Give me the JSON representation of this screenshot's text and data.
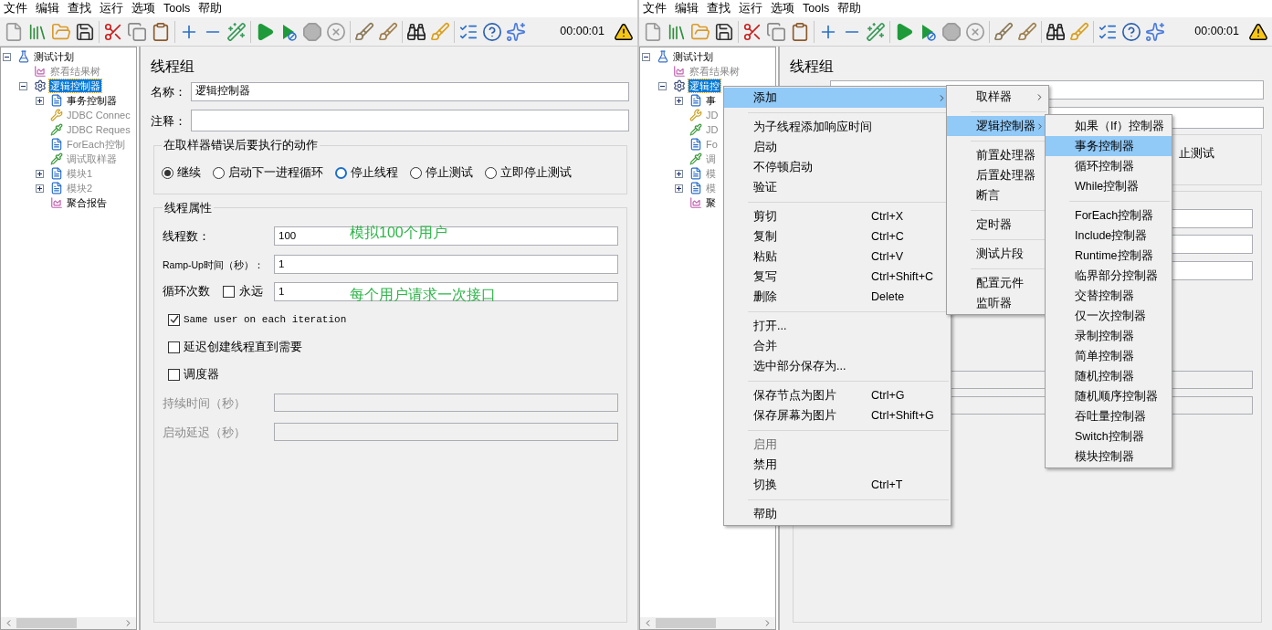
{
  "left": {
    "menubar": [
      "文件",
      "编辑",
      "查找",
      "运行",
      "选项",
      "Tools",
      "帮助"
    ],
    "toolbar": {
      "timer": "00:00:01"
    },
    "tree": [
      {
        "label": "测试计划",
        "kind": "plan",
        "selected": false,
        "disabled": false,
        "expanded": true,
        "children": [
          {
            "label": "察看结果树",
            "kind": "listener",
            "selected": false,
            "disabled": true
          },
          {
            "label": "逻辑控制器",
            "kind": "gear",
            "selected": true,
            "disabled": false,
            "expanded": true,
            "children": [
              {
                "label": "事务控制器",
                "kind": "controller",
                "selected": false,
                "disabled": false,
                "expanded": false
              },
              {
                "label": "JDBC Connec",
                "kind": "config",
                "selected": false,
                "disabled": true
              },
              {
                "label": "JDBC Reques",
                "kind": "sampler",
                "selected": false,
                "disabled": true
              },
              {
                "label": "ForEach控制",
                "kind": "controller",
                "selected": false,
                "disabled": true
              },
              {
                "label": "调试取样器",
                "kind": "sampler",
                "selected": false,
                "disabled": true
              },
              {
                "label": "模块1",
                "kind": "controller",
                "selected": false,
                "disabled": true,
                "expanded": false
              },
              {
                "label": "模块2",
                "kind": "controller",
                "selected": false,
                "disabled": true,
                "expanded": false
              },
              {
                "label": "聚合报告",
                "kind": "listener",
                "selected": false,
                "disabled": false
              }
            ]
          }
        ]
      }
    ],
    "form": {
      "title": "线程组",
      "name": {
        "label": "名称：",
        "value": "逻辑控制器"
      },
      "comment": {
        "label": "注释："
      },
      "error_action": {
        "title": "在取样器错误后要执行的动作",
        "options": [
          {
            "label": "继续",
            "selected": true,
            "focused": false
          },
          {
            "label": "启动下一进程循环",
            "selected": false,
            "focused": false
          },
          {
            "label": "停止线程",
            "selected": false,
            "focused": true
          },
          {
            "label": "停止测试",
            "selected": false,
            "focused": false
          },
          {
            "label": "立即停止测试",
            "selected": false,
            "focused": false
          }
        ]
      },
      "thread_props": {
        "title": "线程属性",
        "threads": {
          "label": "线程数：",
          "value": "100",
          "annotation": "模拟100个用户"
        },
        "rampup": {
          "label": "Ramp-Up时间（秒）：",
          "value": "1"
        },
        "loops": {
          "label": "循环次数",
          "forever": {
            "label": "永远",
            "checked": false
          },
          "value": "1",
          "annotation": "每个用户请求一次接口"
        },
        "checks": [
          {
            "label": "Same user on each iteration",
            "checked": true
          },
          {
            "label": "延迟创建线程直到需要",
            "checked": false
          },
          {
            "label": "调度器",
            "checked": false
          }
        ],
        "duration": {
          "label": "持续时间（秒）",
          "disabled": true
        },
        "delay": {
          "label": "启动延迟（秒）",
          "disabled": true
        }
      }
    }
  },
  "right": {
    "menubar": [
      "文件",
      "编辑",
      "查找",
      "运行",
      "选项",
      "Tools",
      "帮助"
    ],
    "toolbar": {
      "timer": "00:00:01"
    },
    "tree": [
      {
        "label": "测试计划",
        "kind": "plan",
        "selected": false,
        "disabled": false,
        "expanded": true,
        "children": [
          {
            "label": "察看结果树",
            "kind": "listener",
            "selected": false,
            "disabled": true
          },
          {
            "label": "逻辑控",
            "kind": "gear",
            "selected": true,
            "disabled": false,
            "expanded": true,
            "children": [
              {
                "label": "事",
                "kind": "controller",
                "selected": false,
                "disabled": false,
                "expanded": false
              },
              {
                "label": "JD",
                "kind": "config",
                "selected": false,
                "disabled": true
              },
              {
                "label": "JD",
                "kind": "sampler",
                "selected": false,
                "disabled": true
              },
              {
                "label": "Fo",
                "kind": "controller",
                "selected": false,
                "disabled": true
              },
              {
                "label": "调",
                "kind": "sampler",
                "selected": false,
                "disabled": true
              },
              {
                "label": "模",
                "kind": "controller",
                "selected": false,
                "disabled": true,
                "expanded": false
              },
              {
                "label": "模",
                "kind": "controller",
                "selected": false,
                "disabled": true,
                "expanded": false
              },
              {
                "label": "聚",
                "kind": "listener",
                "selected": false,
                "disabled": false
              }
            ]
          }
        ]
      }
    ],
    "form": {
      "title": "线程组",
      "error_action": {
        "fragment": "止测试"
      },
      "thread_props": {
        "duration": {
          "disabled": true
        },
        "delay": {
          "disabled": true
        }
      }
    },
    "context_menu": [
      {
        "kind": "item",
        "label": "添加",
        "submenu": true,
        "selected": true,
        "disabled": false
      },
      {
        "kind": "separator"
      },
      {
        "kind": "item",
        "label": "为子线程添加响应时间",
        "submenu": false,
        "selected": false,
        "disabled": false
      },
      {
        "kind": "item",
        "label": "启动",
        "submenu": false,
        "selected": false,
        "disabled": false
      },
      {
        "kind": "item",
        "label": "不停顿启动",
        "submenu": false,
        "selected": false,
        "disabled": false
      },
      {
        "kind": "item",
        "label": "验证",
        "submenu": false,
        "selected": false,
        "disabled": false
      },
      {
        "kind": "separator"
      },
      {
        "kind": "item",
        "label": "剪切",
        "shortcut": "Ctrl+X",
        "submenu": false,
        "selected": false,
        "disabled": false
      },
      {
        "kind": "item",
        "label": "复制",
        "shortcut": "Ctrl+C",
        "submenu": false,
        "selected": false,
        "disabled": false
      },
      {
        "kind": "item",
        "label": "粘贴",
        "shortcut": "Ctrl+V",
        "submenu": false,
        "selected": false,
        "disabled": false
      },
      {
        "kind": "item",
        "label": "复写",
        "shortcut": "Ctrl+Shift+C",
        "submenu": false,
        "selected": false,
        "disabled": false
      },
      {
        "kind": "item",
        "label": "删除",
        "shortcut": "Delete",
        "submenu": false,
        "selected": false,
        "disabled": false
      },
      {
        "kind": "separator"
      },
      {
        "kind": "item",
        "label": "打开...",
        "submenu": false,
        "selected": false,
        "disabled": false
      },
      {
        "kind": "item",
        "label": "合并",
        "submenu": false,
        "selected": false,
        "disabled": false
      },
      {
        "kind": "item",
        "label": "选中部分保存为...",
        "submenu": false,
        "selected": false,
        "disabled": false
      },
      {
        "kind": "separator"
      },
      {
        "kind": "item",
        "label": "保存节点为图片",
        "shortcut": "Ctrl+G",
        "submenu": false,
        "selected": false,
        "disabled": false
      },
      {
        "kind": "item",
        "label": "保存屏幕为图片",
        "shortcut": "Ctrl+Shift+G",
        "submenu": false,
        "selected": false,
        "disabled": false
      },
      {
        "kind": "separator"
      },
      {
        "kind": "item",
        "label": "启用",
        "submenu": false,
        "selected": false,
        "disabled": true
      },
      {
        "kind": "item",
        "label": "禁用",
        "submenu": false,
        "selected": false,
        "disabled": false
      },
      {
        "kind": "item",
        "label": "切换",
        "shortcut": "Ctrl+T",
        "submenu": false,
        "selected": false,
        "disabled": false
      },
      {
        "kind": "separator"
      },
      {
        "kind": "item",
        "label": "帮助",
        "submenu": false,
        "selected": false,
        "disabled": false
      }
    ],
    "add_submenu": [
      {
        "kind": "item",
        "label": "取样器",
        "submenu": true,
        "selected": false,
        "disabled": false
      },
      {
        "kind": "separator"
      },
      {
        "kind": "item",
        "label": "逻辑控制器",
        "submenu": true,
        "selected": true,
        "disabled": false
      },
      {
        "kind": "separator"
      },
      {
        "kind": "item",
        "label": "前置处理器",
        "submenu": false,
        "selected": false,
        "disabled": false
      },
      {
        "kind": "item",
        "label": "后置处理器",
        "submenu": false,
        "selected": false,
        "disabled": false
      },
      {
        "kind": "item",
        "label": "断言",
        "submenu": false,
        "selected": false,
        "disabled": false
      },
      {
        "kind": "separator"
      },
      {
        "kind": "item",
        "label": "定时器",
        "submenu": false,
        "selected": false,
        "disabled": false
      },
      {
        "kind": "separator"
      },
      {
        "kind": "item",
        "label": "测试片段",
        "submenu": false,
        "selected": false,
        "disabled": false
      },
      {
        "kind": "separator"
      },
      {
        "kind": "item",
        "label": "配置元件",
        "submenu": false,
        "selected": false,
        "disabled": false
      },
      {
        "kind": "item",
        "label": "监听器",
        "submenu": false,
        "selected": false,
        "disabled": false
      }
    ],
    "logic_submenu": [
      {
        "kind": "item",
        "label": "如果（If）控制器",
        "submenu": false,
        "selected": false,
        "disabled": false
      },
      {
        "kind": "item",
        "label": "事务控制器",
        "submenu": false,
        "selected": true,
        "disabled": false
      },
      {
        "kind": "item",
        "label": "循环控制器",
        "submenu": false,
        "selected": false,
        "disabled": false
      },
      {
        "kind": "item",
        "label": "While控制器",
        "submenu": false,
        "selected": false,
        "disabled": false
      },
      {
        "kind": "separator"
      },
      {
        "kind": "item",
        "label": "ForEach控制器",
        "submenu": false,
        "selected": false,
        "disabled": false
      },
      {
        "kind": "item",
        "label": "Include控制器",
        "submenu": false,
        "selected": false,
        "disabled": false
      },
      {
        "kind": "item",
        "label": "Runtime控制器",
        "submenu": false,
        "selected": false,
        "disabled": false
      },
      {
        "kind": "item",
        "label": "临界部分控制器",
        "submenu": false,
        "selected": false,
        "disabled": false
      },
      {
        "kind": "item",
        "label": "交替控制器",
        "submenu": false,
        "selected": false,
        "disabled": false
      },
      {
        "kind": "item",
        "label": "仅一次控制器",
        "submenu": false,
        "selected": false,
        "disabled": false
      },
      {
        "kind": "item",
        "label": "录制控制器",
        "submenu": false,
        "selected": false,
        "disabled": false
      },
      {
        "kind": "item",
        "label": "简单控制器",
        "submenu": false,
        "selected": false,
        "disabled": false
      },
      {
        "kind": "item",
        "label": "随机控制器",
        "submenu": false,
        "selected": false,
        "disabled": false
      },
      {
        "kind": "item",
        "label": "随机顺序控制器",
        "submenu": false,
        "selected": false,
        "disabled": false
      },
      {
        "kind": "item",
        "label": "吞吐量控制器",
        "submenu": false,
        "selected": false,
        "disabled": false
      },
      {
        "kind": "item",
        "label": "Switch控制器",
        "submenu": false,
        "selected": false,
        "disabled": false
      },
      {
        "kind": "item",
        "label": "模块控制器",
        "submenu": false,
        "selected": false,
        "disabled": false
      }
    ]
  }
}
